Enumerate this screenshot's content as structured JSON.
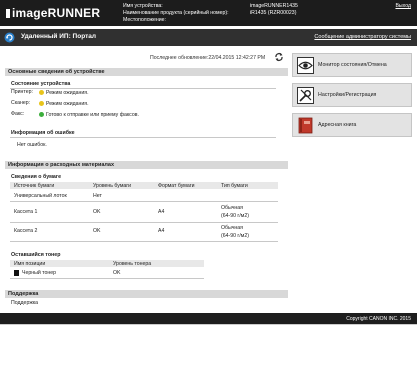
{
  "header": {
    "logo": "imageRUNNER",
    "device_name_label": "Имя устройства:",
    "device_name_value": "imageRUNNER1435",
    "product_name_label": "Наименование продукта (серийный номер):",
    "product_name_value": "iR1435 (RZR00023)",
    "location_label": "Местоположение:",
    "location_value": "",
    "logout": "Выход"
  },
  "portal": {
    "title": "Удаленный ИП: Портал",
    "admin_link": "Сообщение администратору системы"
  },
  "updated": "Последнее обновление:22/04.2015 12:42:27 PM",
  "device_info": {
    "title": "Основные сведения об устройстве",
    "status_title": "Состояние устройства",
    "rows": [
      {
        "label": "Принтер:",
        "value": "Режим ожидания.",
        "color": "#e8c41a"
      },
      {
        "label": "Сканер:",
        "value": "Режим ожидания.",
        "color": "#e8c41a"
      },
      {
        "label": "Факс:",
        "value": "Готово к отправке или приему факсов.",
        "color": "#3cae3c"
      }
    ],
    "error_title": "Информация об ошибке",
    "error_text": "Нет ошибок."
  },
  "consumables": {
    "title": "Информация о расходных материалах",
    "paper_title": "Сведения о бумаге",
    "paper_headers": [
      "Источник бумаги",
      "Уровень бумаги",
      "Формат бумаги",
      "Тип бумаги"
    ],
    "paper_rows": [
      {
        "source": "Универсальный лоток",
        "level": "Нет",
        "format": "",
        "type1": "",
        "type2": ""
      },
      {
        "source": "Кассета 1",
        "level": "OK",
        "format": "A4",
        "type1": "Обычная",
        "type2": "(64-90 г/м2)"
      },
      {
        "source": "Кассета 2",
        "level": "OK",
        "format": "A4",
        "type1": "Обычная",
        "type2": "(64-90 г/м2)"
      }
    ],
    "toner_title": "Оставшийся тонер",
    "toner_headers": [
      "Имя позиции",
      "Уровень тонера"
    ],
    "toner_rows": [
      {
        "name": "Черный тонер",
        "level": "OK",
        "color": "#111111"
      }
    ]
  },
  "support": {
    "title": "Поддержка",
    "text": "Поддержка"
  },
  "side": {
    "monitor": "Монитор состояния/Отмена",
    "settings": "Настройки/Регистрация",
    "address": "Адресная книга"
  },
  "footer": {
    "copyright": "Copyright CANON INC. 2015"
  }
}
